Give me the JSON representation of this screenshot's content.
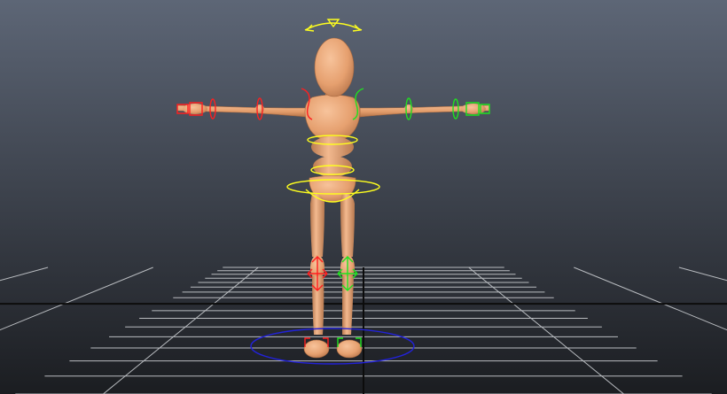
{
  "viewport": {
    "view": "perspective",
    "background": {
      "top": "#5d6676",
      "bottom": "#1b1d21"
    },
    "grid": {
      "visible": true,
      "line_color": "#b9bcc0",
      "axis_color": "#0c0c0c"
    }
  },
  "character": {
    "skin_color": "#e8a070",
    "skin_shade": "#b8744a",
    "pose": "T-pose"
  },
  "rig_controls": {
    "colors": {
      "left_side": "#ff1f1f",
      "right_side": "#1fe21f",
      "center": "#ffff1e",
      "root": "#2222d8"
    },
    "controls": [
      "head-control",
      "chest-control",
      "hip-control",
      "root-control",
      "left-arm-ik",
      "right-arm-ik",
      "left-knee-control",
      "right-knee-control",
      "left-foot-control",
      "right-foot-control"
    ]
  }
}
